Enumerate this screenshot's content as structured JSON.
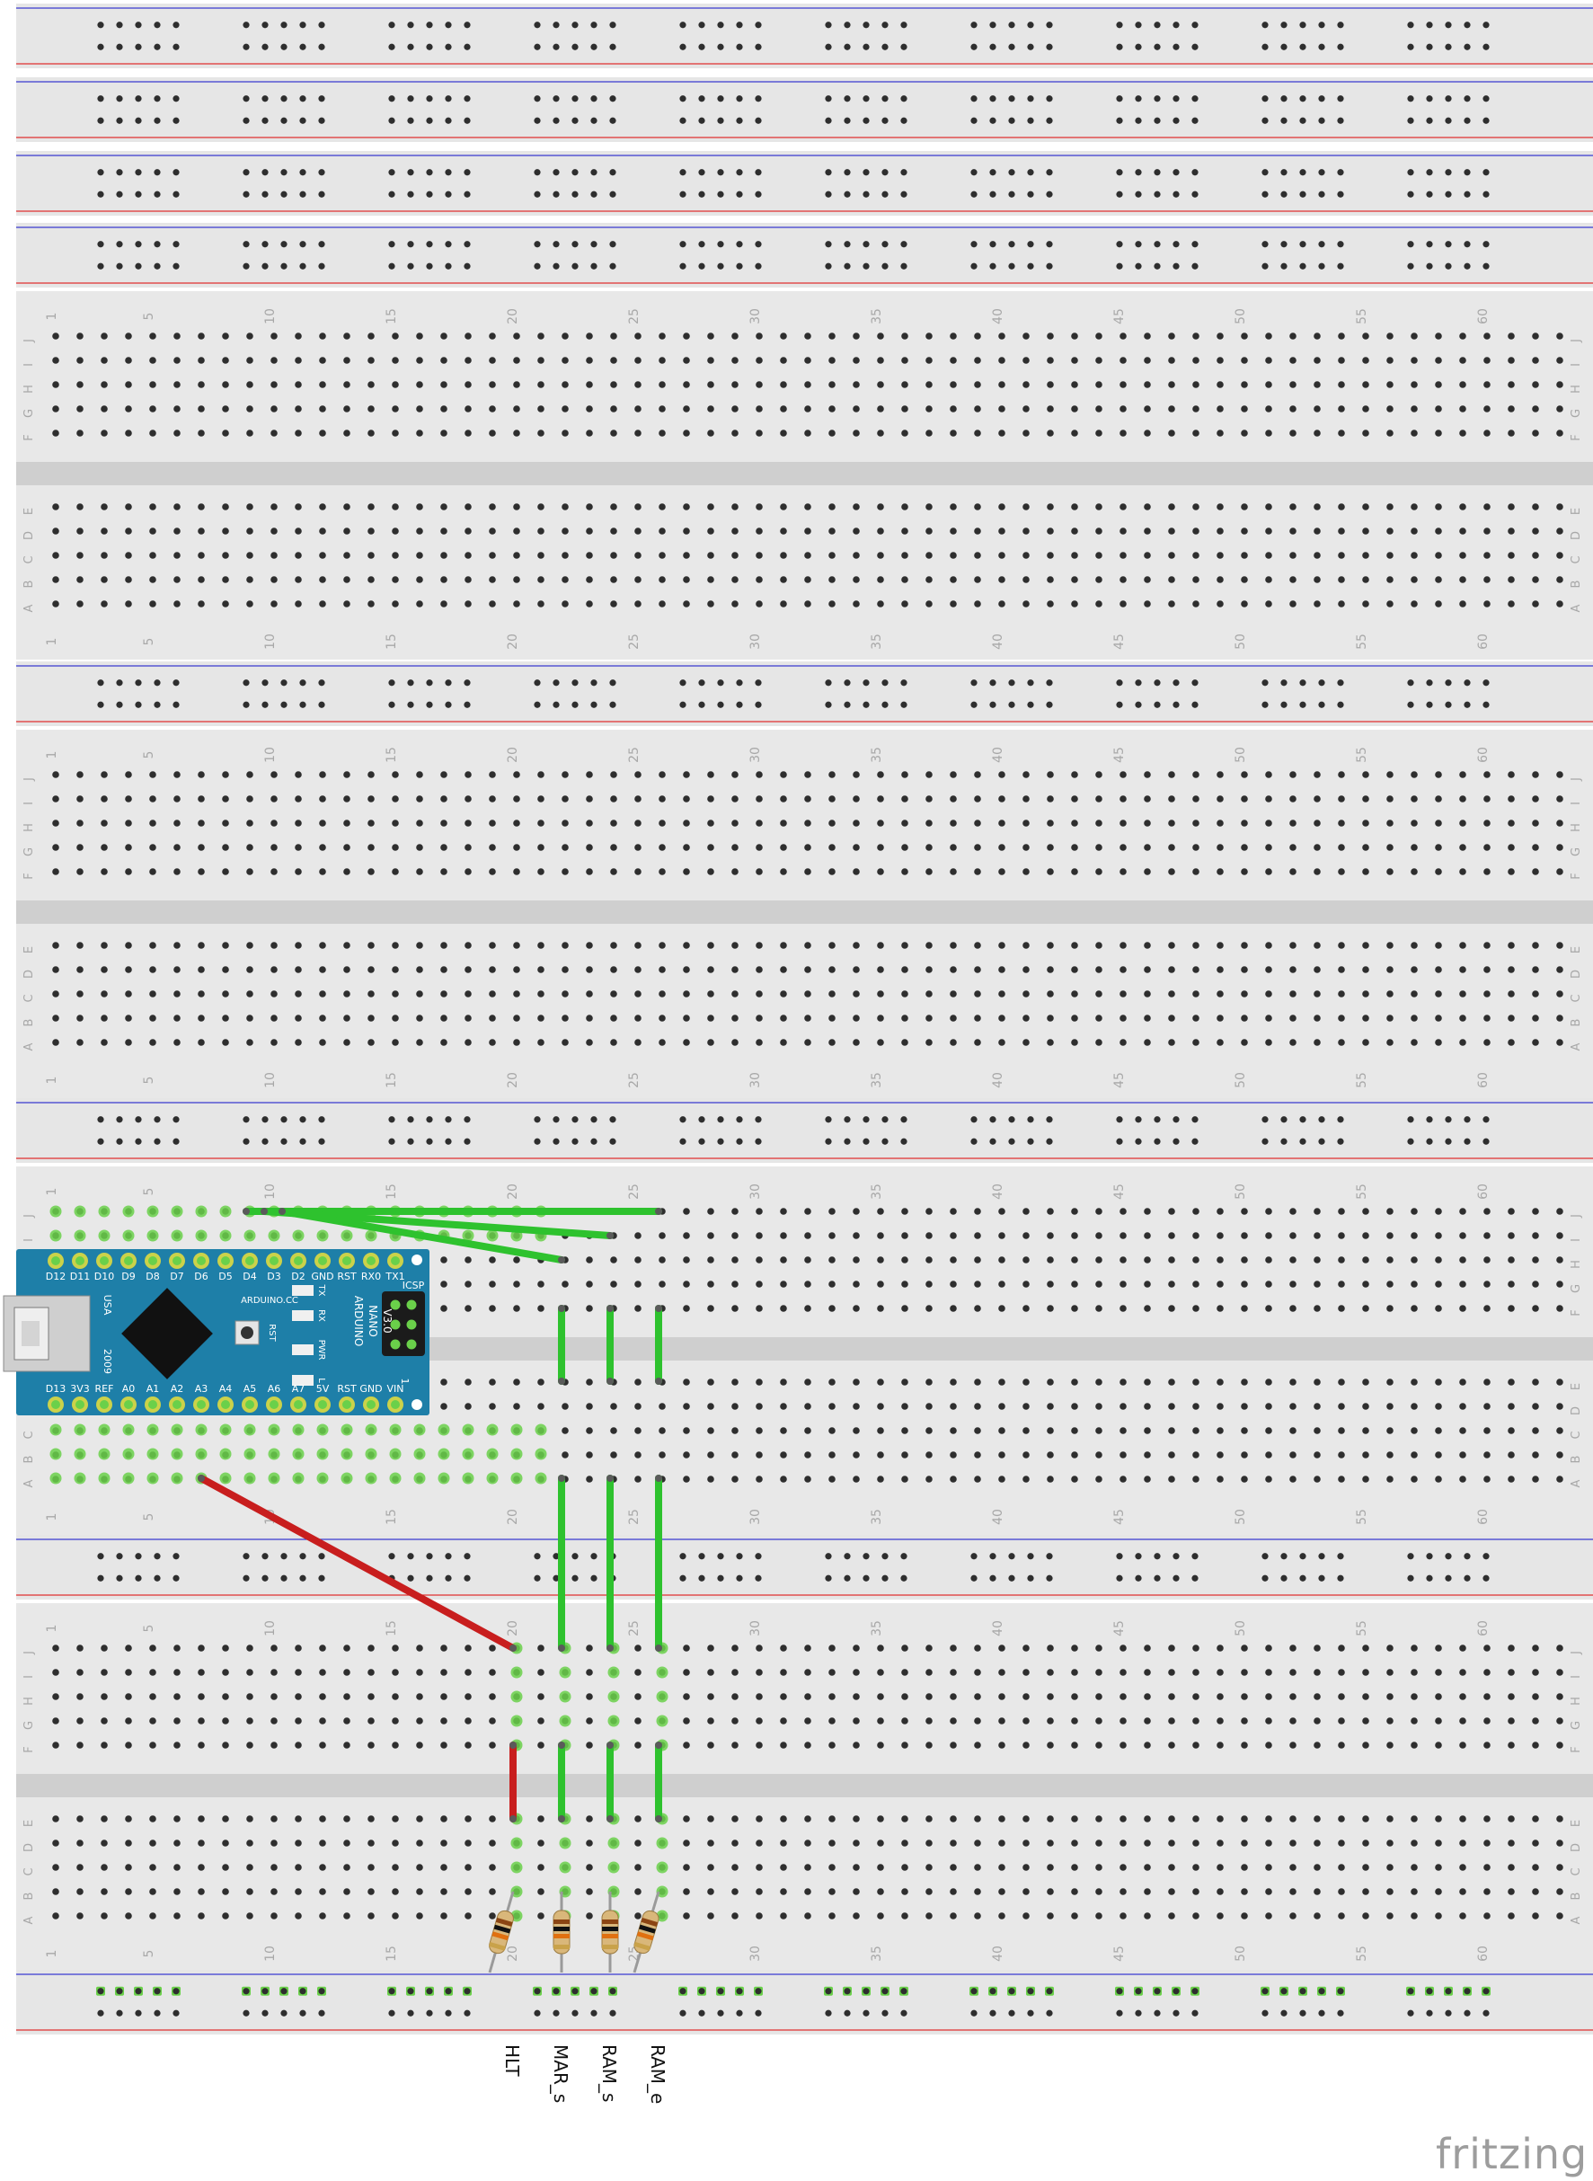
{
  "app": {
    "logo_text": "fritzing"
  },
  "breadboards": [
    {
      "name": "breadboard-1",
      "column_numbers": [
        "1",
        "5",
        "10",
        "15",
        "20",
        "25",
        "30",
        "35",
        "40",
        "45",
        "50",
        "55",
        "60"
      ],
      "top_rows": [
        "J",
        "I",
        "H",
        "G",
        "F"
      ],
      "bottom_rows": [
        "E",
        "D",
        "C",
        "B",
        "A"
      ]
    },
    {
      "name": "breadboard-2",
      "column_numbers": [
        "1",
        "5",
        "10",
        "15",
        "20",
        "25",
        "30",
        "35",
        "40",
        "45",
        "50",
        "55",
        "60"
      ],
      "top_rows": [
        "J",
        "I",
        "H",
        "G",
        "F"
      ],
      "bottom_rows": [
        "E",
        "D",
        "C",
        "B",
        "A"
      ]
    },
    {
      "name": "breadboard-3",
      "column_numbers": [
        "1",
        "5",
        "10",
        "15",
        "20",
        "25",
        "30",
        "35",
        "40",
        "45",
        "50",
        "55",
        "60"
      ],
      "top_rows": [
        "J",
        "I",
        "H",
        "G",
        "F"
      ],
      "bottom_rows": [
        "E",
        "D",
        "C",
        "B",
        "A"
      ]
    },
    {
      "name": "breadboard-4",
      "column_numbers": [
        "1",
        "5",
        "10",
        "15",
        "20",
        "25",
        "30",
        "35",
        "40",
        "45",
        "50",
        "55",
        "60"
      ],
      "top_rows": [
        "J",
        "I",
        "H",
        "G",
        "F"
      ],
      "bottom_rows": [
        "E",
        "D",
        "C",
        "B",
        "A"
      ]
    }
  ],
  "arduino": {
    "top_pins": [
      "D12",
      "D11",
      "D10",
      "D9",
      "D8",
      "D7",
      "D6",
      "D5",
      "D4",
      "D3",
      "D2",
      "GND",
      "RST",
      "RX0",
      "TX1"
    ],
    "bottom_pins": [
      "D13",
      "3V3",
      "REF",
      "A0",
      "A1",
      "A2",
      "A3",
      "A4",
      "A5",
      "A6",
      "A7",
      "5V",
      "RST",
      "GND",
      "VIN"
    ],
    "board_text": [
      "ARDUINO",
      "NANO",
      "V3.0"
    ],
    "website": "ARDUINO.CC",
    "usb_label": "USA",
    "year": "2009",
    "icsp": "ICSP",
    "led_labels": [
      "TX",
      "RX",
      "PWR",
      "L"
    ],
    "button_label": "RST",
    "pin1_label": "1",
    "color": "#1e7fa8"
  },
  "signal_labels": [
    "HLT",
    "MAR_s",
    "RAM_s",
    "RAM_e"
  ],
  "colors": {
    "board": "#dcdcdc",
    "rail_top": "#e6e6e6",
    "blue_line": "#3a3ad0",
    "red_line": "#e03030",
    "hole": "#2e2e2e",
    "active": "#6ad04a",
    "wire_green": "#2ec22e",
    "wire_red": "#c81e1e"
  }
}
